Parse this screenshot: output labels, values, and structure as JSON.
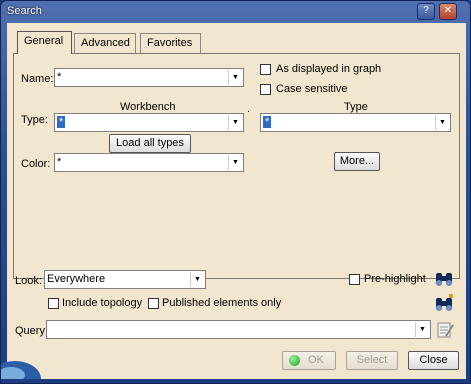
{
  "window": {
    "title": "Search"
  },
  "titlebar": {
    "help": "?",
    "close": "✕"
  },
  "tabs": [
    {
      "label": "General",
      "active": true
    },
    {
      "label": "Advanced",
      "active": false
    },
    {
      "label": "Favorites",
      "active": false
    }
  ],
  "general": {
    "name_label": "Name:",
    "name_value": "*",
    "as_displayed_label": "As displayed in graph",
    "case_sensitive_label": "Case sensitive",
    "workbench_header": "Workbench",
    "dot_separator": ".",
    "type_header": "Type",
    "type_label": "Type:",
    "workbench_value": "*",
    "type_value": "*",
    "load_all_label": "Load all types",
    "color_label": "Color:",
    "color_value": "*",
    "more_label": "More..."
  },
  "bottom": {
    "look_label": "Look:",
    "look_value": "Everywhere",
    "prehighlight_label": "Pre-highlight",
    "include_topology_label": "Include topology",
    "published_only_label": "Published elements only",
    "query_label": "Query:",
    "query_value": ""
  },
  "footer": {
    "ok_label": "OK",
    "select_label": "Select",
    "close_label": "Close"
  }
}
